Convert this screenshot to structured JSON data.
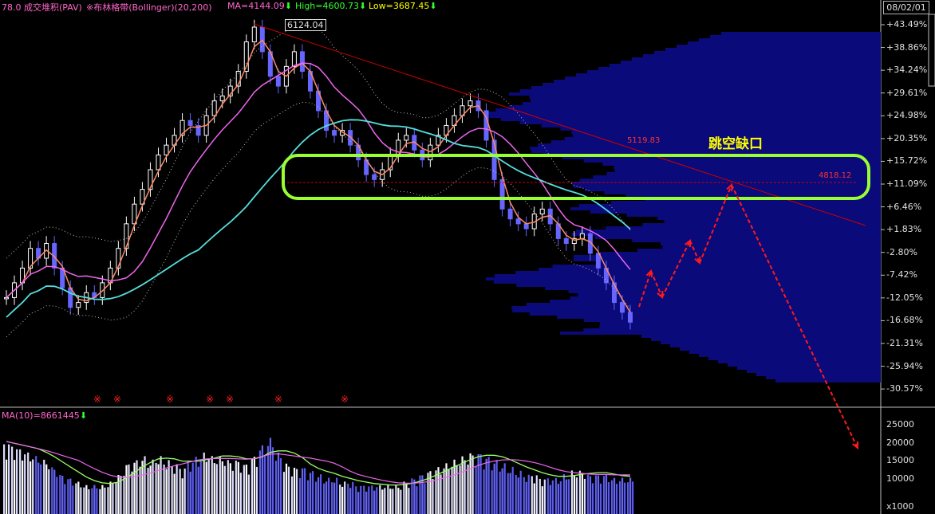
{
  "header": {
    "indicator_volume_profile": "78.0 成交堆积(PAV)",
    "indicator_bollinger": "※布林格带(Bollinger)(20,200)",
    "ma_text": "MA=4144.09",
    "high_text": "High=4600.73",
    "low_text": "Low=3687.45",
    "arrow_icon": "down-arrow-icon"
  },
  "date_label": "08/02/01",
  "annotations": {
    "peak_price": "6124.04",
    "resistance_price": "5119.83",
    "gap_price": "4818.12",
    "gap_text": "跳空缺口"
  },
  "volume_header": "MA(10)=8661445",
  "colors": {
    "background": "#000000",
    "up_candle": "#ffffff",
    "down_candle": "#6666ff",
    "ma_short": "#ff8866",
    "ma_pink": "#ee66ee",
    "ma_teal": "#55dddd",
    "bollinger_dots": "#bbbbbb",
    "volume_profile": "#0a0a7a",
    "gap_box": "#99ff33",
    "trendline": "#cc0000",
    "volume_ma": "#99ff66"
  },
  "chart_data": [
    {
      "type": "line",
      "title": "",
      "y_axis_labels": [
        "+43.49%",
        "+38.86%",
        "+34.24%",
        "+29.61%",
        "+24.98%",
        "+20.35%",
        "+15.72%",
        "+11.09%",
        "+6.46%",
        "+1.83%",
        "-2.80%",
        "-7.42%",
        "-12.05%",
        "-16.68%",
        "-21.31%",
        "-25.94%",
        "-30.57%"
      ],
      "series": [
        {
          "name": "",
          "values": [
            -12,
            -9,
            -6,
            -2,
            -4,
            -1,
            -6,
            -10,
            -14,
            -13,
            -11,
            -12,
            -9,
            -6,
            -2,
            3,
            7,
            10,
            14,
            17,
            19,
            21,
            24,
            23,
            21,
            25,
            28,
            29,
            31,
            34,
            40,
            43,
            38,
            33,
            31,
            35,
            38,
            34,
            30,
            26,
            22,
            21,
            22,
            19,
            16,
            13,
            12,
            14,
            17,
            20,
            21,
            18,
            16,
            19,
            21,
            23,
            25,
            27,
            28,
            26,
            20,
            12,
            6,
            4,
            3,
            2,
            5,
            6,
            3,
            0,
            -1,
            0,
            1,
            -3,
            -6,
            -9,
            -13,
            -15,
            -17
          ]
        }
      ],
      "markers": [
        "※",
        "※",
        "※",
        "※",
        "※",
        "※",
        "※"
      ]
    },
    {
      "type": "bar",
      "title": "",
      "y_axis_labels": [
        "25000",
        "20000",
        "15000",
        "10000",
        "x1000"
      ],
      "series": [
        {
          "name": "",
          "values": [
            20,
            19,
            18,
            17,
            16,
            15,
            13,
            11,
            10,
            9,
            8,
            8,
            8,
            9,
            11,
            14,
            15,
            16,
            15,
            16,
            15,
            14,
            13,
            15,
            16,
            17,
            16,
            16,
            15,
            15,
            14,
            16,
            19,
            21,
            17,
            14,
            13,
            13,
            12,
            11,
            10,
            10,
            9,
            9,
            8,
            8,
            8,
            8,
            8,
            8,
            9,
            10,
            11,
            12,
            13,
            14,
            15,
            16,
            17,
            17,
            16,
            15,
            14,
            13,
            12,
            11,
            11,
            10,
            10,
            10,
            11,
            12,
            12,
            11,
            11,
            11,
            10,
            10,
            10
          ]
        }
      ]
    }
  ]
}
